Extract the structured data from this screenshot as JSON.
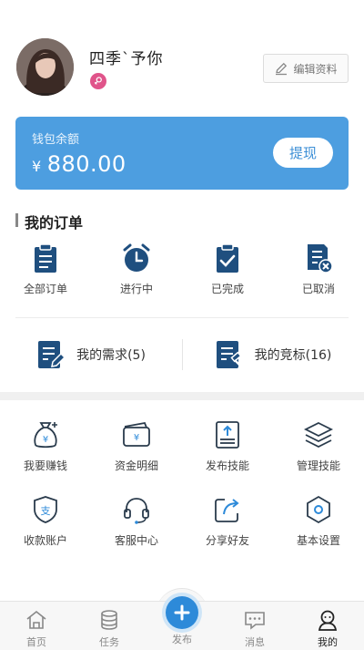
{
  "profile": {
    "username": "四季`予你",
    "edit_label": "编辑资料"
  },
  "wallet": {
    "label": "钱包余额",
    "currency": "¥",
    "amount": "880.00",
    "withdraw_label": "提现"
  },
  "orders": {
    "title": "我的订单",
    "items": [
      {
        "label": "全部订单",
        "icon": "clipboard-list-icon"
      },
      {
        "label": "进行中",
        "icon": "alarm-clock-icon"
      },
      {
        "label": "已完成",
        "icon": "clipboard-check-icon"
      },
      {
        "label": "已取消",
        "icon": "document-cancel-icon"
      }
    ]
  },
  "needs": [
    {
      "label": "我的需求(5)",
      "icon": "document-edit-icon"
    },
    {
      "label": "我的竞标(16)",
      "icon": "document-gavel-icon"
    }
  ],
  "grid": [
    {
      "label": "我要赚钱",
      "icon": "money-bag-icon"
    },
    {
      "label": "资金明细",
      "icon": "wallet-icon"
    },
    {
      "label": "发布技能",
      "icon": "upload-icon"
    },
    {
      "label": "管理技能",
      "icon": "layers-icon"
    },
    {
      "label": "收款账户",
      "icon": "shield-pay-icon"
    },
    {
      "label": "客服中心",
      "icon": "headset-icon"
    },
    {
      "label": "分享好友",
      "icon": "share-icon"
    },
    {
      "label": "基本设置",
      "icon": "hexagon-settings-icon"
    }
  ],
  "tabs": [
    {
      "label": "首页",
      "icon": "home-icon"
    },
    {
      "label": "任务",
      "icon": "database-icon"
    },
    {
      "label": "发布",
      "icon": "plus-circle-icon"
    },
    {
      "label": "消息",
      "icon": "chat-icon"
    },
    {
      "label": "我的",
      "icon": "user-icon",
      "active": true
    }
  ],
  "colors": {
    "accent": "#2d8ad9",
    "wallet_bg": "#4d9ee0",
    "icon_dark": "#2a3b4c",
    "gender_female": "#e0548a"
  }
}
